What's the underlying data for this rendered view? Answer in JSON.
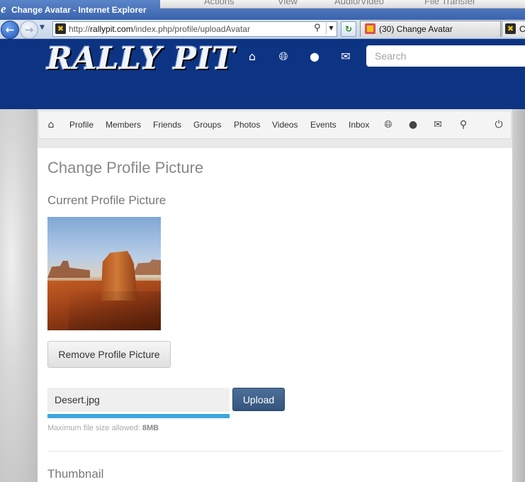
{
  "browser": {
    "window_title": "Change Avatar - Internet Explorer",
    "logo_glyph": "e",
    "address": {
      "scheme": "http://",
      "domain": "rallypit.com",
      "path": "/index.php/profile/uploadAvatar"
    },
    "tabs": [
      {
        "label": "(30) Change Avatar",
        "active": true
      },
      {
        "label": "Ci",
        "active": false
      }
    ],
    "background_toolbar_items": [
      "Actions",
      "View",
      "Audio/Video",
      "File Transfer"
    ]
  },
  "site": {
    "logo_text": "RALLY PIT",
    "header_icons": [
      "home-icon",
      "globe-icon",
      "user-icon",
      "envelope-icon"
    ],
    "search_placeholder": "Search",
    "brand_color": "#0c3483"
  },
  "toolbar": {
    "items": [
      "Profile",
      "Members",
      "Friends",
      "Groups",
      "Photos",
      "Videos",
      "Events",
      "Inbox"
    ],
    "right_icons": [
      "globe-icon",
      "users-icon",
      "envelope-icon",
      "search-icon",
      "power-icon"
    ]
  },
  "page": {
    "title": "Change Profile Picture",
    "current_heading": "Current Profile Picture",
    "remove_button": "Remove Profile Picture",
    "file_name": "Desert.jpg",
    "upload_progress": 1.0,
    "upload_button": "Upload",
    "max_size_label": "Maximum file size allowed:",
    "max_size_value": "8MB",
    "thumbnail_heading": "Thumbnail",
    "accent_color": "#3fa6df"
  }
}
